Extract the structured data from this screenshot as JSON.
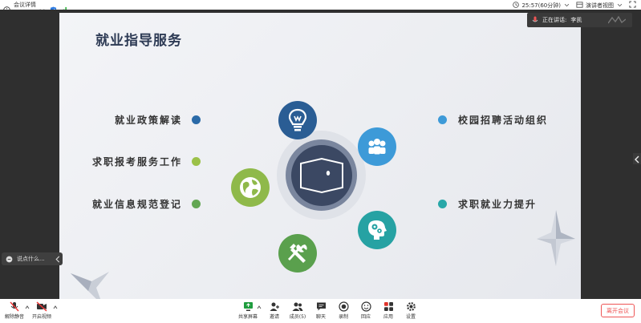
{
  "topbar": {
    "meeting_info_label": "会议详情",
    "timer": "25:57(60分钟)",
    "view_label": "演讲者视图",
    "icons": [
      "info-icon",
      "shield-icon",
      "signal-icon",
      "fullscreen-icon"
    ]
  },
  "speaker": {
    "label": "正在讲话:",
    "name": "李凯"
  },
  "chat": {
    "placeholder": "说点什么..."
  },
  "slide": {
    "title": "就业指导服务",
    "left_items": [
      {
        "label": "就业政策解读",
        "color": "#2a6aa8"
      },
      {
        "label": "求职报考服务工作",
        "color": "#9bc148"
      },
      {
        "label": "就业信息规范登记",
        "color": "#63a653"
      }
    ],
    "right_items": [
      {
        "label": "校园招聘活动组织",
        "color": "#3d9ad8"
      },
      {
        "label": "求职就业力提升",
        "color": "#28a7a8"
      }
    ],
    "colors": {
      "navy": "#2a5d94",
      "sky": "#3d9ad8",
      "olive": "#8fb94a",
      "teal": "#26a2a3",
      "green": "#5aa04d"
    }
  },
  "toolbar": {
    "mute": "解除静音",
    "video": "开启视频",
    "share": "共享屏幕",
    "invite": "邀请",
    "members": "成员(5)",
    "chat": "聊天",
    "record": "录制",
    "reactions": "回应",
    "apps": "应用",
    "settings": "设置",
    "leave": "离开会议"
  }
}
